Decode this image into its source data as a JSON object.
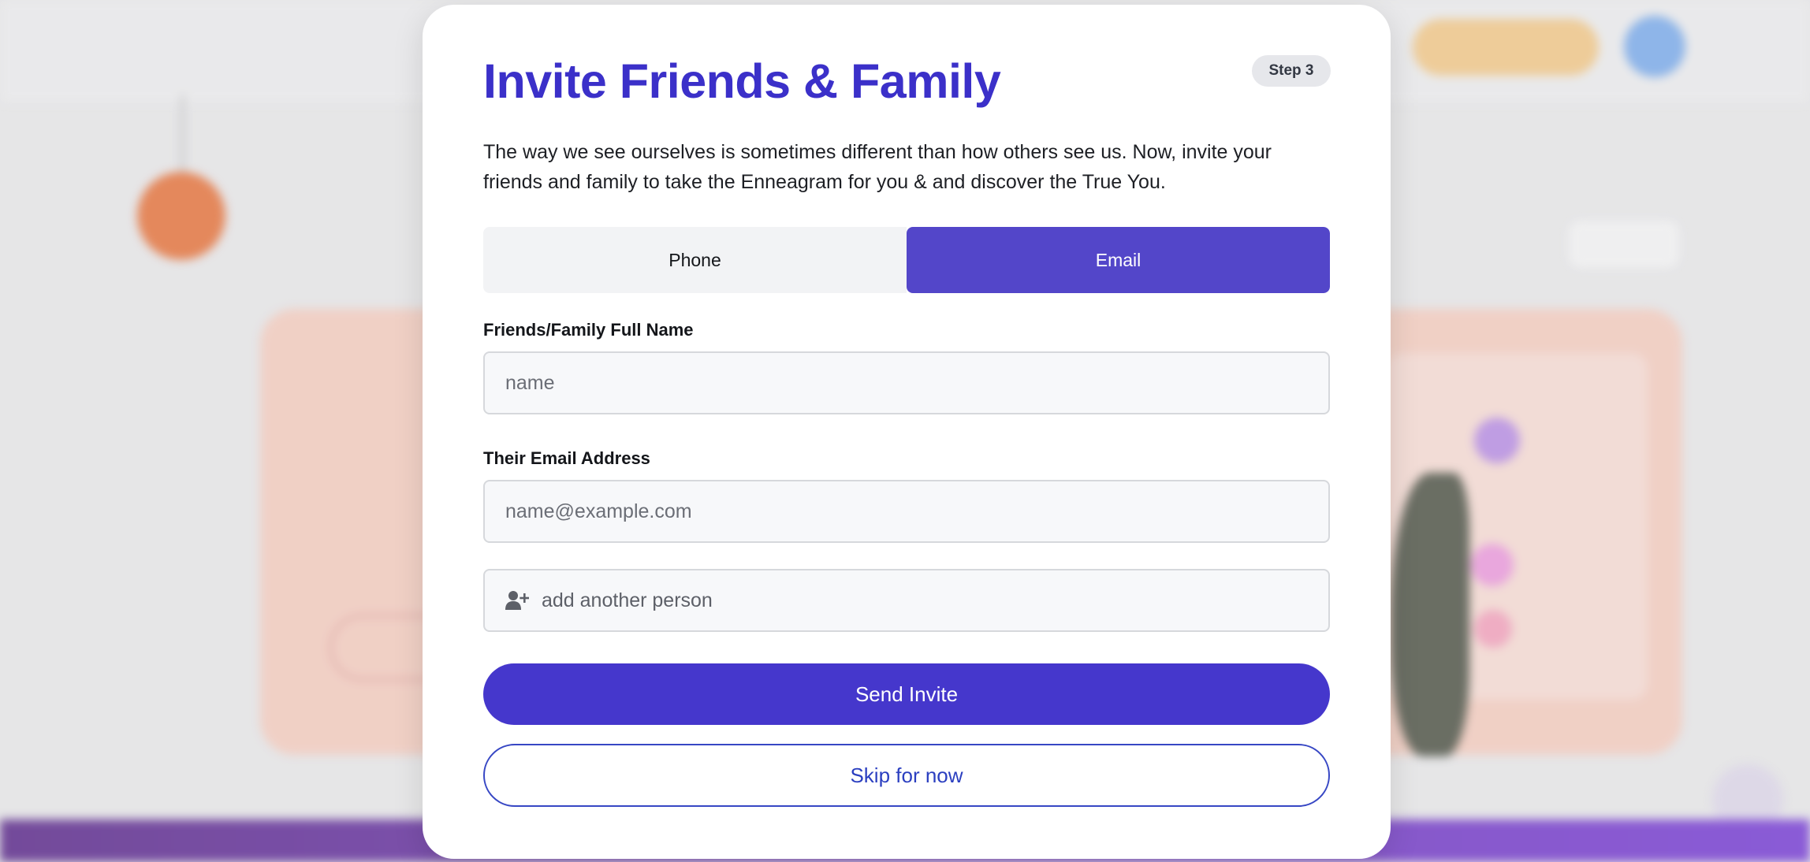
{
  "modal": {
    "title": "Invite Friends & Family",
    "step_badge": "Step 3",
    "intro": "The way we see ourselves is sometimes different than how others see us. Now, invite your friends and family to take the Enneagram for you & and discover the True You.",
    "tabs": [
      {
        "label": "Phone",
        "active": false
      },
      {
        "label": "Email",
        "active": true
      }
    ],
    "name_field": {
      "label": "Friends/Family Full Name",
      "value": "",
      "placeholder": "name"
    },
    "email_field": {
      "label": "Their Email Address",
      "value": "",
      "placeholder": "name@example.com"
    },
    "add_person": {
      "label": "add another person",
      "icon": "add-user-icon"
    },
    "send_label": "Send Invite",
    "skip_label": "Skip for now"
  },
  "colors": {
    "accent": "#4537cc",
    "title": "#3b30c9",
    "tab_active": "#5346c9",
    "skip_text": "#2b3fc0"
  }
}
